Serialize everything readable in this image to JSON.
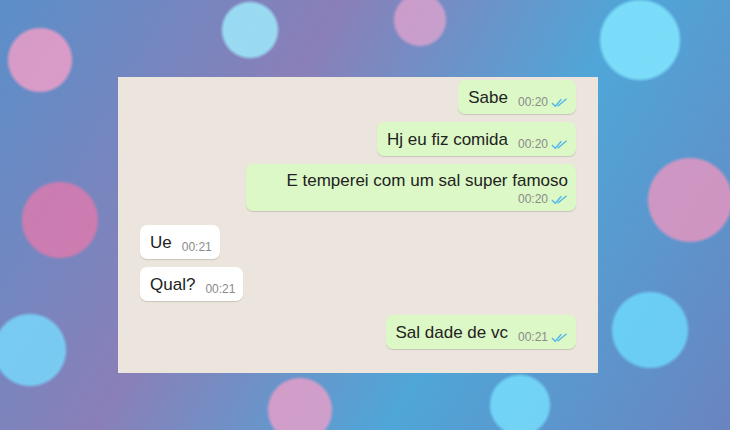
{
  "messages": [
    {
      "text": "Sabe",
      "time": "00:20",
      "kind": "sent",
      "read": true
    },
    {
      "text": "Hj eu fiz comida",
      "time": "00:20",
      "kind": "sent",
      "read": true
    },
    {
      "text": "E temperei com um sal super famoso",
      "time": "00:20",
      "kind": "sent",
      "read": true
    },
    {
      "text": "Ue",
      "time": "00:21",
      "kind": "received"
    },
    {
      "text": "Qual?",
      "time": "00:21",
      "kind": "received"
    },
    {
      "text": "Sal dade de vc",
      "time": "00:21",
      "kind": "sent",
      "read": true
    }
  ]
}
